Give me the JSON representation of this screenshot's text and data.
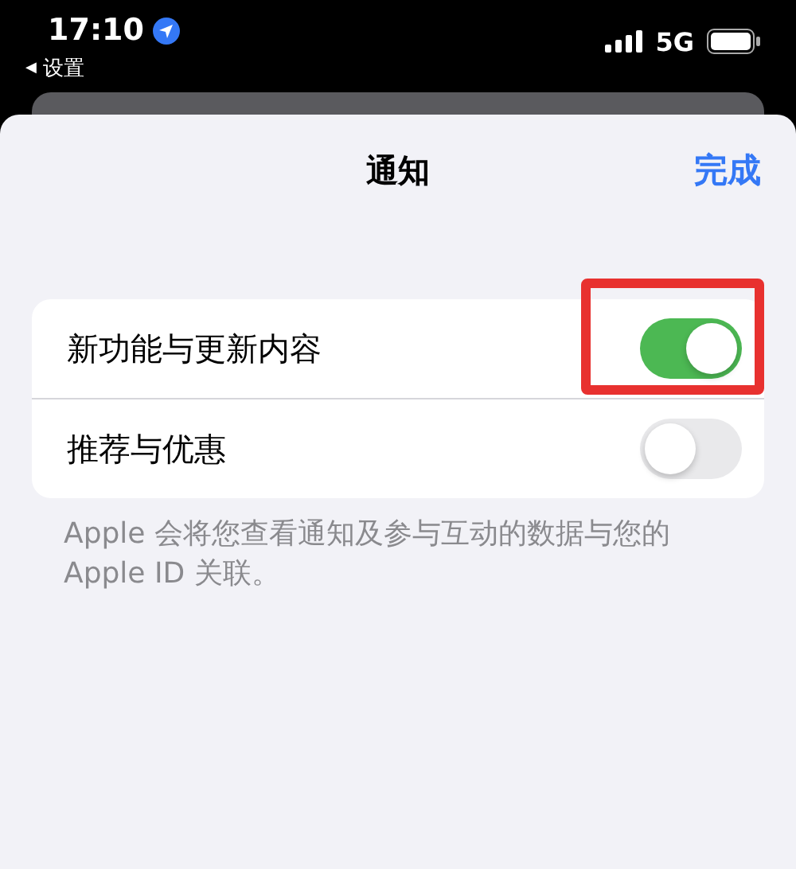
{
  "status_bar": {
    "time": "17:10",
    "back": {
      "glyph": "◀",
      "label": "设置"
    },
    "network": "5G"
  },
  "nav": {
    "title": "通知",
    "done": "完成"
  },
  "settings": [
    {
      "label": "新功能与更新内容",
      "on": true,
      "highlighted": true
    },
    {
      "label": "推荐与优惠",
      "on": false,
      "highlighted": false
    }
  ],
  "footer": "Apple 会将您查看通知及参与互动的数据与您的 Apple ID 关联。"
}
